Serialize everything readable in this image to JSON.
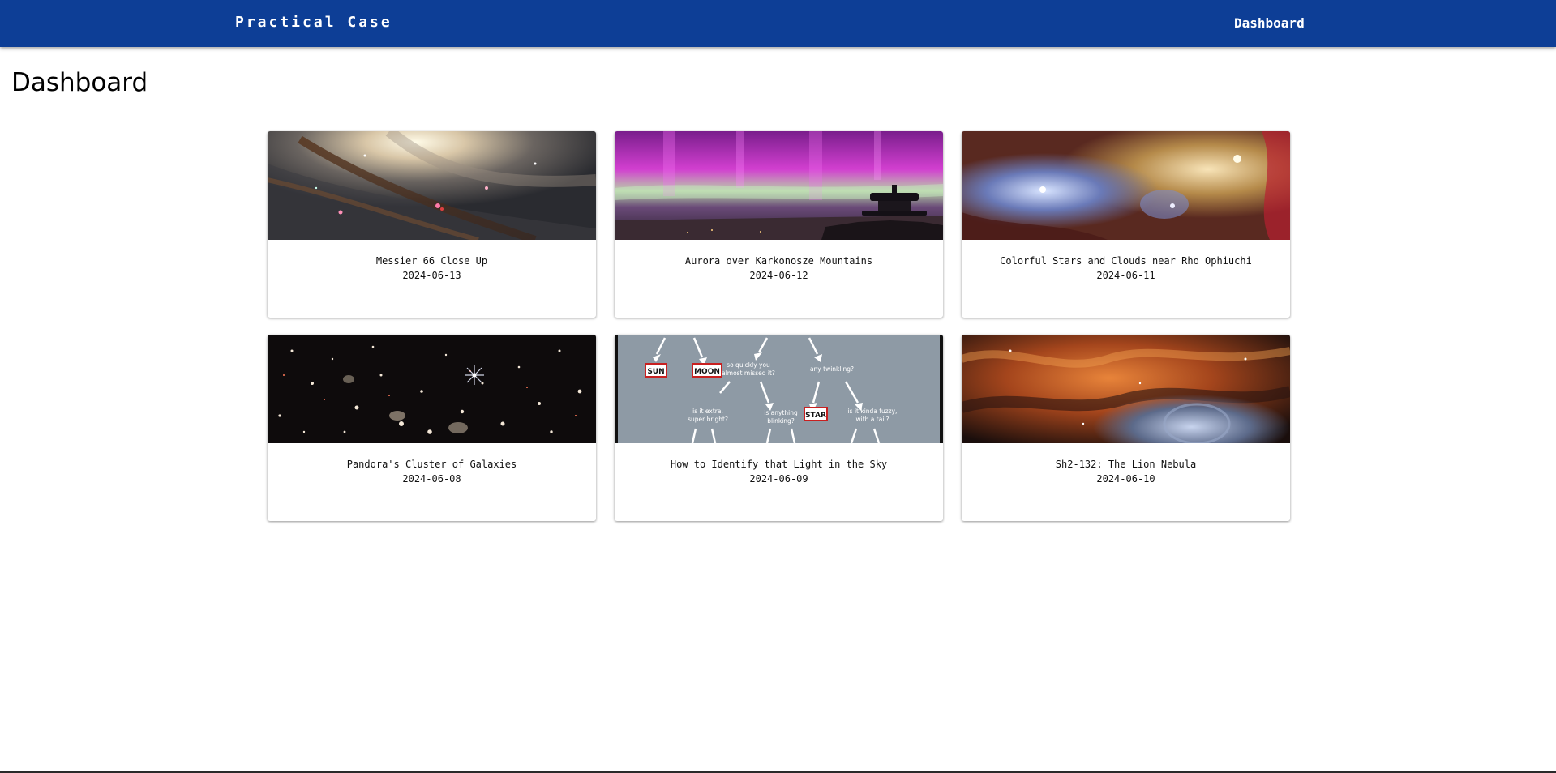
{
  "header": {
    "brand": "Practical Case",
    "nav_dashboard": "Dashboard"
  },
  "page": {
    "title": "Dashboard"
  },
  "cards": [
    {
      "title": "Messier 66 Close Up",
      "date": "2024-06-13",
      "image": "galaxy-photo"
    },
    {
      "title": "Aurora over Karkonosze Mountains",
      "date": "2024-06-12",
      "image": "aurora-photo"
    },
    {
      "title": "Colorful Stars and Clouds near Rho Ophiuchi",
      "date": "2024-06-11",
      "image": "nebula-photo"
    },
    {
      "title": "Pandora's Cluster of Galaxies",
      "date": "2024-06-08",
      "image": "galaxy-cluster-photo"
    },
    {
      "title": "How to Identify that Light in the Sky",
      "date": "2024-06-09",
      "image": "flowchart-illustration",
      "diagram_text": {
        "sun": "SUN",
        "moon": "MOON",
        "star": "STAR",
        "q1a": "so quickly you",
        "q1b": "almost missed it?",
        "q2": "any twinkling?",
        "q3a": "is it extra,",
        "q3b": "super bright?",
        "q4a": "is anything",
        "q4b": "blinking?",
        "q5a": "is it kinda fuzzy,",
        "q5b": "with a tail?"
      }
    },
    {
      "title": "Sh2-132: The Lion Nebula",
      "date": "2024-06-10",
      "image": "lion-nebula-photo"
    }
  ]
}
